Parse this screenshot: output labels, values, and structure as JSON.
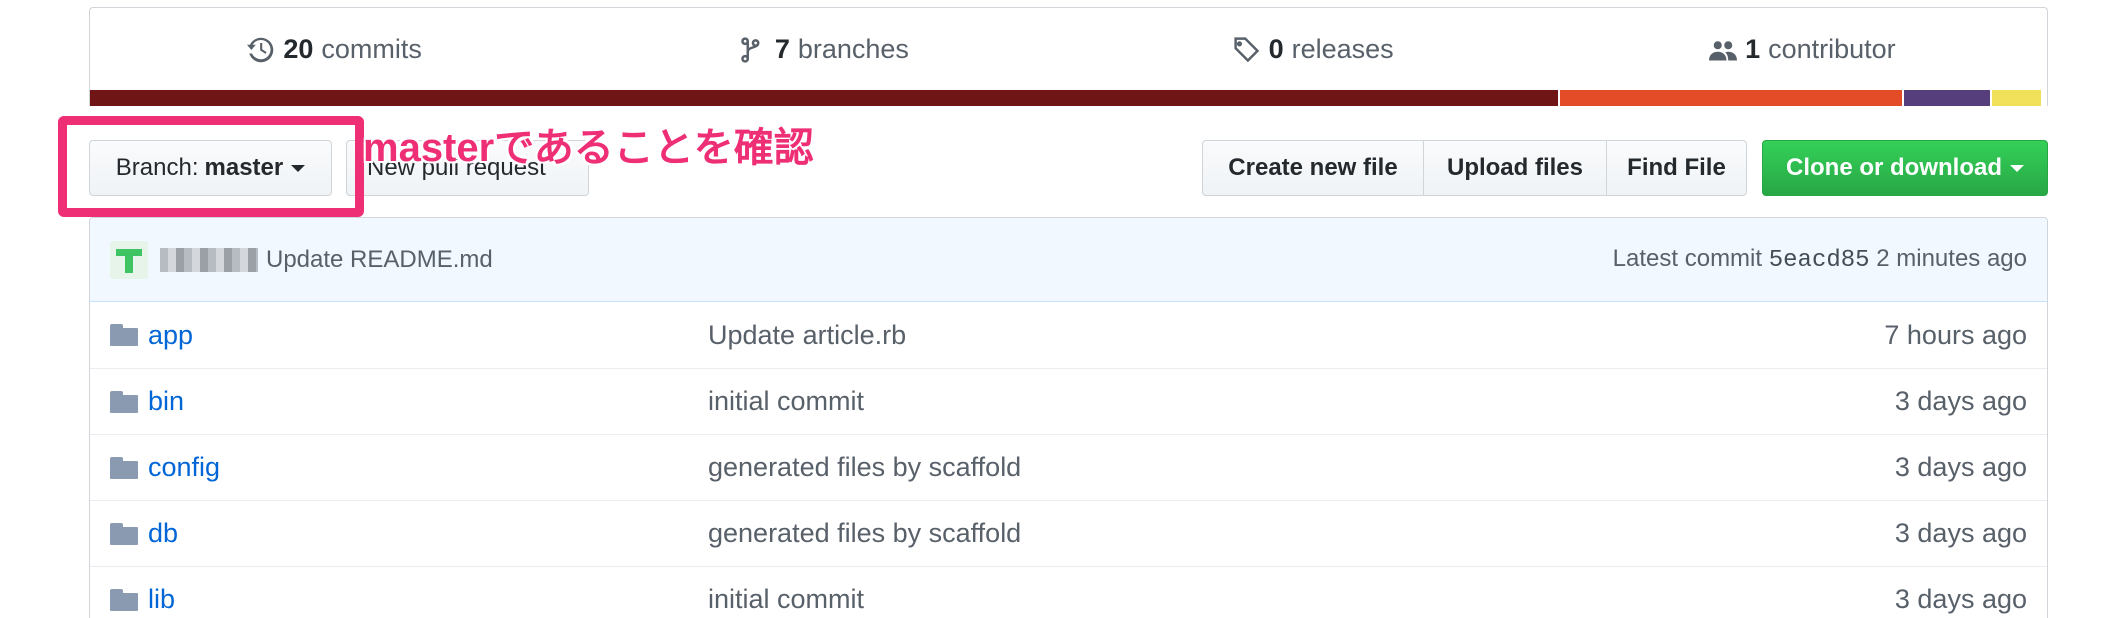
{
  "summary": {
    "commits_count": "20",
    "commits_label": "commits",
    "branches_count": "7",
    "branches_label": "branches",
    "releases_count": "0",
    "releases_label": "releases",
    "contributors_count": "1",
    "contributors_label": "contributor",
    "language_colors": [
      "#701516",
      "#e34c26",
      "#563d7c",
      "#f1e05a"
    ],
    "language_shares": [
      0.75,
      0.176,
      0.045,
      0.026
    ]
  },
  "controls": {
    "branch_label": "Branch:",
    "branch_value": "master",
    "new_pr_label": "New pull request",
    "create_file_label": "Create new file",
    "upload_files_label": "Upload files",
    "find_file_label": "Find File",
    "clone_label": "Clone or download"
  },
  "annotation": {
    "text": "masterであることを確認",
    "color": "#ee2f76"
  },
  "commit_tease": {
    "message": "Update README.md",
    "latest_label": "Latest commit",
    "sha": "5eacd85",
    "age": "2 minutes ago"
  },
  "files": [
    {
      "name": "app",
      "message": "Update article.rb",
      "age": "7 hours ago"
    },
    {
      "name": "bin",
      "message": "initial commit",
      "age": "3 days ago"
    },
    {
      "name": "config",
      "message": "generated files by scaffold",
      "age": "3 days ago"
    },
    {
      "name": "db",
      "message": "generated files by scaffold",
      "age": "3 days ago"
    },
    {
      "name": "lib",
      "message": "initial commit",
      "age": "3 days ago"
    }
  ]
}
